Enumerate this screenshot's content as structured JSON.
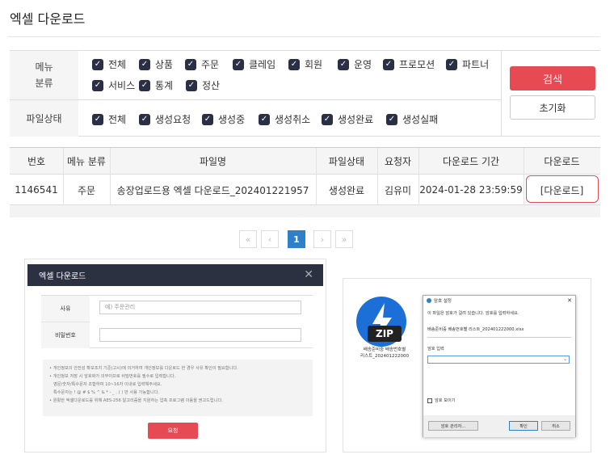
{
  "page": {
    "title": "엑셀 다운로드"
  },
  "filters": {
    "menu": {
      "label": "메뉴\n분류",
      "options": [
        "전체",
        "상품",
        "주문",
        "클레임",
        "회원",
        "운영",
        "프로모션",
        "파트너",
        "서비스",
        "통계",
        "정산"
      ]
    },
    "status": {
      "label": "파일상태",
      "options": [
        "전체",
        "생성요청",
        "생성중",
        "생성취소",
        "생성완료",
        "생성실패"
      ]
    }
  },
  "buttons": {
    "search": "검색",
    "reset": "초기화"
  },
  "table": {
    "headers": [
      "번호",
      "메뉴 분류",
      "파일명",
      "파일상태",
      "요청자",
      "다운로드 기간",
      "다운로드"
    ],
    "rows": [
      [
        "1146541",
        "주문",
        "송장업로드용 엑셀 다운로드_202401221957",
        "생성완료",
        "김유미",
        "2024-01-28 23:59:59",
        "[다운로드]"
      ]
    ]
  },
  "pagination": {
    "first": "«",
    "prev": "‹",
    "current": "1",
    "next": "›",
    "last": "»"
  },
  "modal": {
    "title": "엑셀 다운로드",
    "reason_label": "사유",
    "reason_placeholder": "예) 주문관리",
    "password_label": "비밀번호",
    "notes": [
      "• 개인정보의 안전성 확보조치 기준(고시)에 의거하여 개인정보를 다운로드 한 경우 사유 확인이 필요합니다.",
      "• 개인정보 저장 시 암호화가 의무이므로 비밀번호를 필수로 입력합니다.",
      "영문/숫자/특수문자 조합하여 10~16자 이내로 입력해주세요.",
      "특수문자는 ! @ # $ % ^ & * - _ . ( ) 만 사용 가능합니다.",
      "• 원활한 엑셀다운로드를 위해 AES-256 알고리즘을 지원하는 압축 프로그램 이용을 권고드립니다."
    ],
    "submit": "요청"
  },
  "zip": {
    "icon_text": "ZIP",
    "file_label": "배송준비중 배송번호별\n리스트_202401222000",
    "dialog_title": "암호 설정",
    "dialog_msg": "이 파일은 암호가 걸려 있습니다. 암호를 입력하세요.",
    "dialog_file": "배송준비중 배송번호별 리스트_202401222000.xlsx",
    "pw_label": "암호 입력",
    "show_pw": "암호 보이기",
    "manage_btn": "암호 관리자...",
    "ok_btn": "확인",
    "cancel_btn": "취소"
  },
  "colors": {
    "accent": "#e84a54",
    "checkbox": "#2a2f45",
    "page_active": "#2e80c8"
  }
}
